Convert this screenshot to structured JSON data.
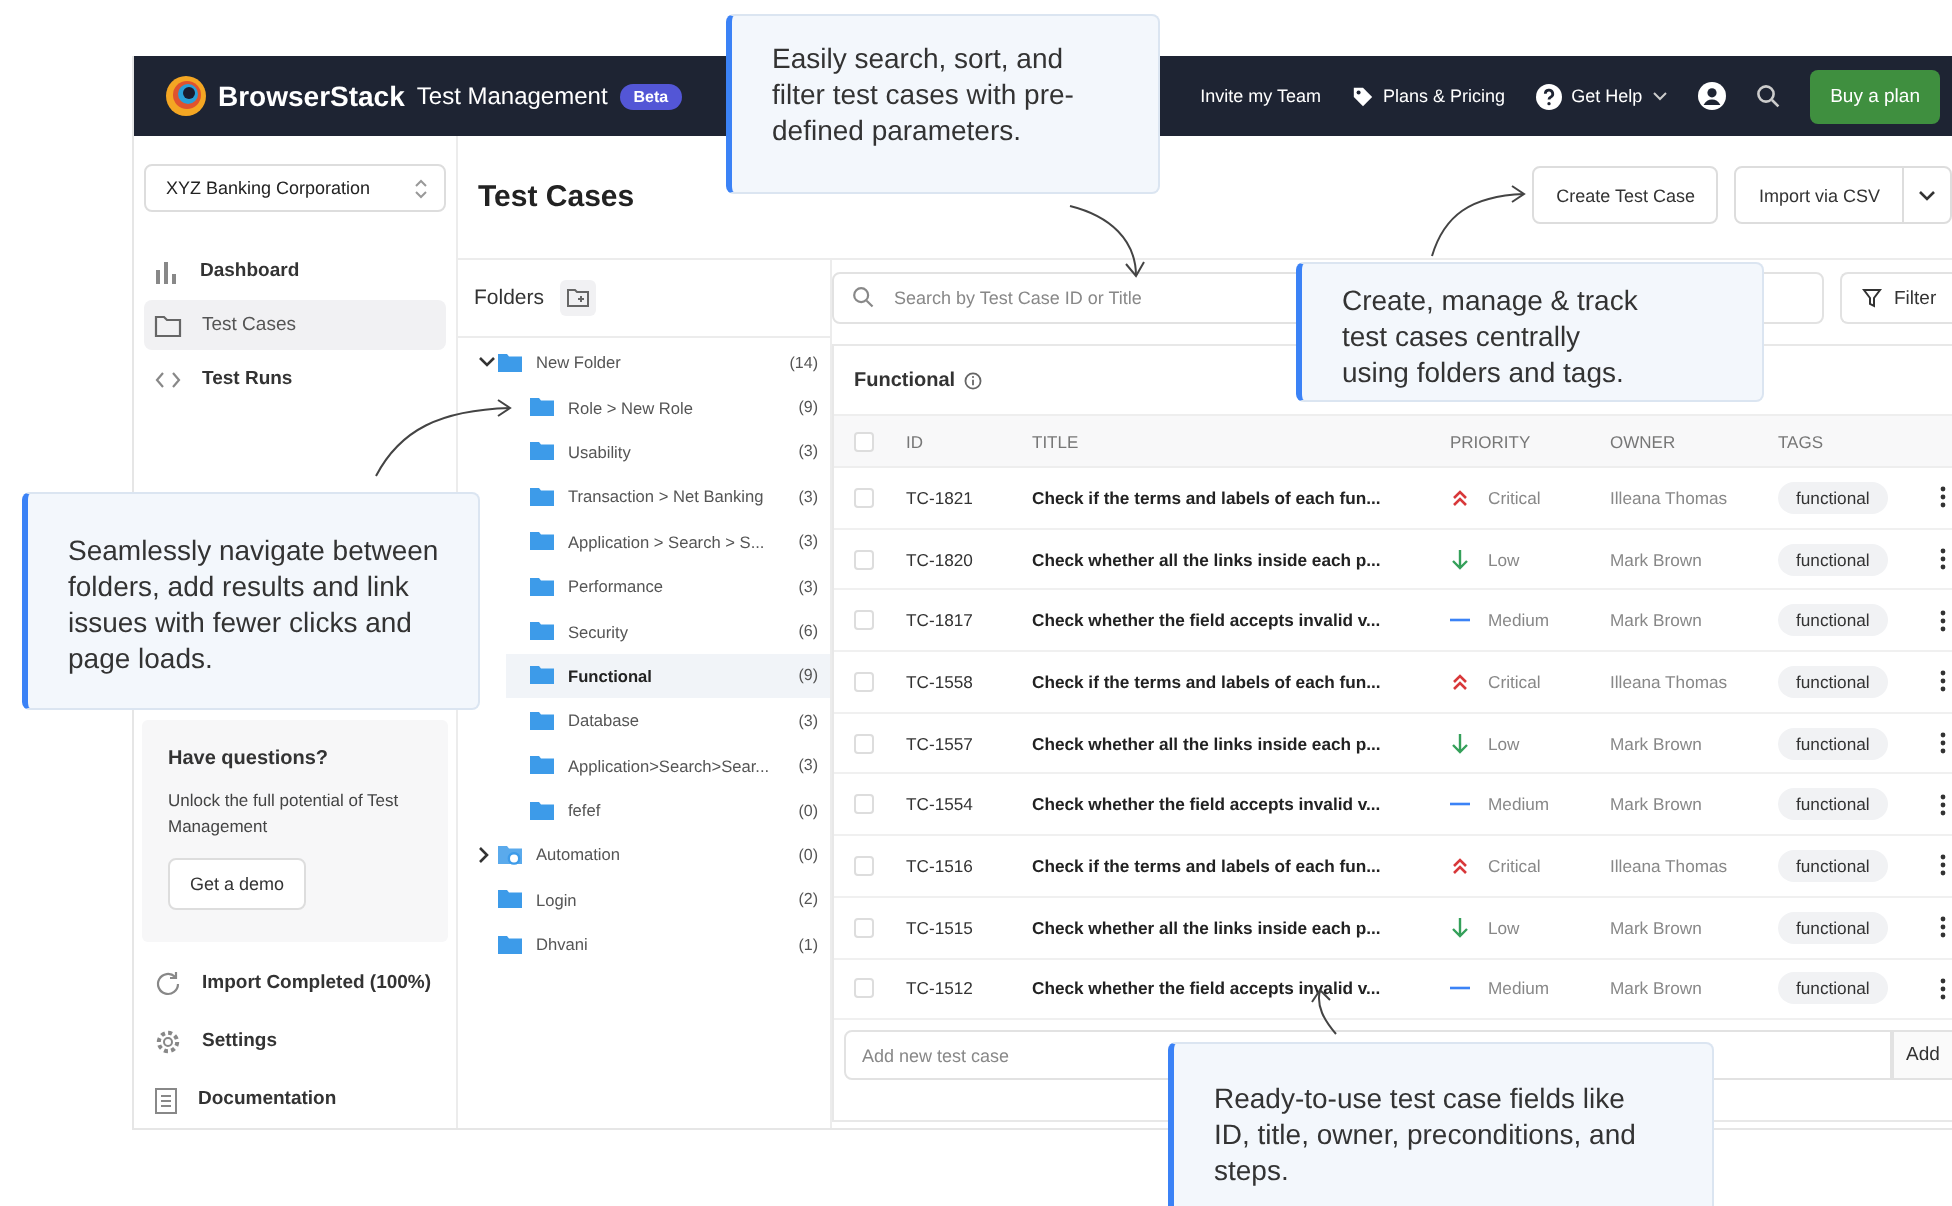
{
  "topbar": {
    "brand": "BrowserStack",
    "product": "Test Management",
    "badge": "Beta",
    "invite_link": "Invite my Team",
    "pricing_link": "Plans & Pricing",
    "help_menu": "Get Help",
    "buy_button": "Buy a plan"
  },
  "sidebar": {
    "project": "XYZ Banking Corporation",
    "nav": [
      {
        "label": "Dashboard",
        "selected": false
      },
      {
        "label": "Test Cases",
        "selected": true
      },
      {
        "label": "Test Runs",
        "selected": false
      }
    ],
    "promo": {
      "title": "Have questions?",
      "text": "Unlock the full potential of Test Management",
      "button": "Get a demo"
    },
    "footer": [
      {
        "label": "Import Completed (100%)"
      },
      {
        "label": "Settings"
      },
      {
        "label": "Documentation"
      }
    ]
  },
  "header": {
    "title": "Test Cases",
    "buttons": [
      "Create Test Case",
      "Import via CSV"
    ]
  },
  "folders": {
    "title": "Folders",
    "tree": [
      {
        "kind": "folder",
        "name": "New Folder",
        "count": "(14)",
        "expanded": true,
        "selected": false,
        "children": [
          {
            "name": "Role > New Role",
            "count": "(9)",
            "selected": false
          },
          {
            "name": "Usability",
            "count": "(3)",
            "selected": false
          },
          {
            "name": "Transaction > Net Banking",
            "count": "(3)",
            "selected": false
          },
          {
            "name": "Application > Search > S...",
            "count": "(3)",
            "selected": false
          },
          {
            "name": "Performance",
            "count": "(3)",
            "selected": false
          },
          {
            "name": "Security",
            "count": "(6)",
            "selected": false
          },
          {
            "name": "Functional",
            "count": "(9)",
            "selected": true
          },
          {
            "name": "Database",
            "count": "(3)",
            "selected": false
          },
          {
            "name": "Application>Search>Sear...",
            "count": "(3)",
            "selected": false
          },
          {
            "name": "fefef",
            "count": "(0)",
            "selected": false
          }
        ]
      },
      {
        "kind": "automation",
        "name": "Automation",
        "count": "(0)",
        "expanded": false,
        "selected": false
      },
      {
        "kind": "folder",
        "name": "Login",
        "count": "(2)",
        "selected": false
      },
      {
        "kind": "folder",
        "name": "Dhvani",
        "count": "(1)",
        "selected": false
      }
    ]
  },
  "search": {
    "placeholder": "Search by Test Case ID or Title"
  },
  "filter_button": "Filter",
  "table": {
    "title": "Functional",
    "select_all_checked": false,
    "columns": [
      "ID",
      "TITLE",
      "PRIORITY",
      "OWNER",
      "TAGS"
    ],
    "rows": [
      {
        "checked": false,
        "id": "TC-1821",
        "title": "Check if the terms and labels of each fun...",
        "priority": {
          "kind": "critical",
          "label": "Critical"
        },
        "owner": "Illeana Thomas",
        "tag": "functional"
      },
      {
        "checked": false,
        "id": "TC-1820",
        "title": "Check whether all the links inside each p...",
        "priority": {
          "kind": "low",
          "label": "Low"
        },
        "owner": "Mark Brown",
        "tag": "functional"
      },
      {
        "checked": false,
        "id": "TC-1817",
        "title": "Check whether the field accepts invalid v...",
        "priority": {
          "kind": "medium",
          "label": "Medium"
        },
        "owner": "Mark Brown",
        "tag": "functional"
      },
      {
        "checked": false,
        "id": "TC-1558",
        "title": "Check if the terms and labels of each fun...",
        "priority": {
          "kind": "critical",
          "label": "Critical"
        },
        "owner": "Illeana Thomas",
        "tag": "functional"
      },
      {
        "checked": false,
        "id": "TC-1557",
        "title": "Check whether all the links inside each p...",
        "priority": {
          "kind": "low",
          "label": "Low"
        },
        "owner": "Mark Brown",
        "tag": "functional"
      },
      {
        "checked": false,
        "id": "TC-1554",
        "title": "Check whether the field accepts invalid v...",
        "priority": {
          "kind": "medium",
          "label": "Medium"
        },
        "owner": "Mark Brown",
        "tag": "functional"
      },
      {
        "checked": false,
        "id": "TC-1516",
        "title": "Check if the terms and labels of each fun...",
        "priority": {
          "kind": "critical",
          "label": "Critical"
        },
        "owner": "Illeana Thomas",
        "tag": "functional"
      },
      {
        "checked": false,
        "id": "TC-1515",
        "title": "Check whether all the links inside each p...",
        "priority": {
          "kind": "low",
          "label": "Low"
        },
        "owner": "Mark Brown",
        "tag": "functional"
      },
      {
        "checked": false,
        "id": "TC-1512",
        "title": "Check whether the field accepts invalid v...",
        "priority": {
          "kind": "medium",
          "label": "Medium"
        },
        "owner": "Mark Brown",
        "tag": "functional"
      }
    ]
  },
  "add_row": {
    "placeholder": "Add new test case",
    "button": "Add"
  },
  "callouts": [
    "Easily search, sort, and filter test cases with pre-defined parameters.",
    "Create, manage & track test cases centrally using folders and tags.",
    "Seamlessly navigate between folders, add results and link issues with fewer clicks and page loads.",
    "Ready-to-use test case fields like ID, title, owner, preconditions, and steps."
  ]
}
